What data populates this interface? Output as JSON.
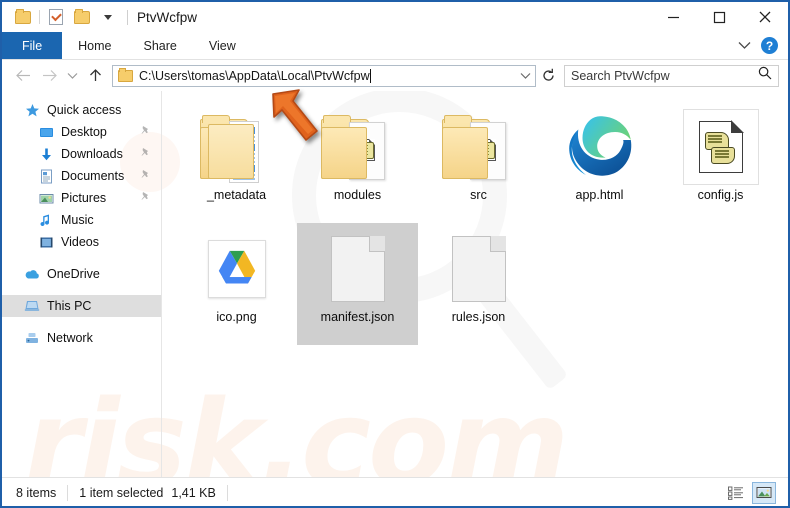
{
  "window": {
    "title": "PtvWcfpw",
    "quick_access_icons": [
      "folder-icon",
      "properties-icon",
      "new-folder-icon",
      "customize-caret-icon"
    ],
    "controls": {
      "minimize": "minimize-button",
      "maximize": "maximize-button",
      "close": "close-button"
    }
  },
  "ribbon": {
    "tabs": [
      {
        "label": "File",
        "active": true
      },
      {
        "label": "Home",
        "active": false
      },
      {
        "label": "Share",
        "active": false
      },
      {
        "label": "View",
        "active": false
      }
    ],
    "collapse_icon": "chevron-down-icon",
    "help_label": "?"
  },
  "address": {
    "back_icon": "back-arrow-icon",
    "forward_icon": "forward-arrow-icon",
    "recent_icon": "recent-locations-chevron-icon",
    "up_icon": "up-arrow-icon",
    "path": "C:\\Users\\tomas\\AppData\\Local\\PtvWcfpw",
    "dropdown_icon": "chevron-down-icon",
    "refresh_icon": "refresh-icon"
  },
  "search": {
    "placeholder": "Search PtvWcfpw",
    "icon": "search-icon"
  },
  "sidebar": {
    "groups": [
      {
        "name": "Quick access",
        "icon": "star-icon",
        "items": [
          {
            "label": "Desktop",
            "icon": "desktop-icon",
            "pinned": true
          },
          {
            "label": "Downloads",
            "icon": "downloads-icon",
            "pinned": true
          },
          {
            "label": "Documents",
            "icon": "documents-icon",
            "pinned": true
          },
          {
            "label": "Pictures",
            "icon": "pictures-icon",
            "pinned": true
          },
          {
            "label": "Music",
            "icon": "music-icon",
            "pinned": false
          },
          {
            "label": "Videos",
            "icon": "videos-icon",
            "pinned": false
          }
        ]
      },
      {
        "name": "OneDrive",
        "icon": "onedrive-icon",
        "items": []
      },
      {
        "name": "This PC",
        "icon": "this-pc-icon",
        "items": [],
        "selected": true
      },
      {
        "name": "Network",
        "icon": "network-icon",
        "items": []
      }
    ]
  },
  "files": [
    {
      "name": "_metadata",
      "type": "folder-with-document",
      "selected": false
    },
    {
      "name": "modules",
      "type": "folder-with-script",
      "selected": false
    },
    {
      "name": "src",
      "type": "folder-with-script",
      "selected": false
    },
    {
      "name": "app.html",
      "type": "edge-html",
      "selected": false
    },
    {
      "name": "config.js",
      "type": "windows-script",
      "selected": false
    },
    {
      "name": "ico.png",
      "type": "google-drive-image",
      "selected": false
    },
    {
      "name": "manifest.json",
      "type": "blank-document",
      "selected": true
    },
    {
      "name": "rules.json",
      "type": "blank-document",
      "selected": false
    }
  ],
  "annotation": {
    "arrow": "orange-pointer-arrow",
    "color": "#e0621f"
  },
  "statusbar": {
    "item_count": "8 items",
    "selection": "1 item selected",
    "size": "1,41 KB",
    "view_details_icon": "details-view-icon",
    "view_large_icons_icon": "large-icons-view-icon"
  },
  "watermark": {
    "text": "risk.com",
    "glass": "magnifier-watermark"
  },
  "colors": {
    "accent": "#1b66b0",
    "window_border": "#1f5fa9",
    "selection": "#cfcfcf",
    "annotation": "#e0621f"
  }
}
